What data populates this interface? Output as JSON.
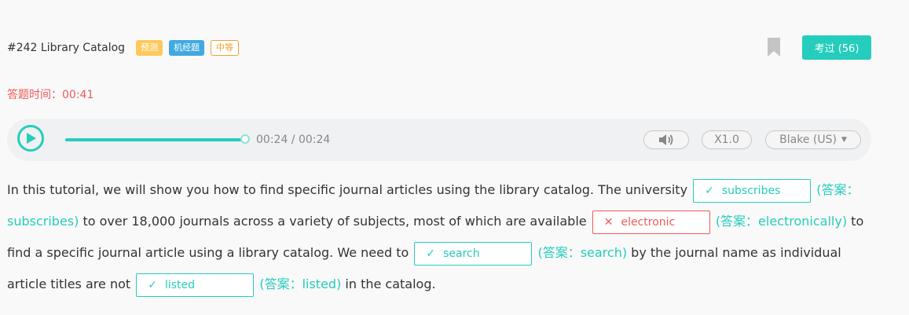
{
  "header": {
    "title": "#242 Library Catalog",
    "tags": [
      "预测",
      "机经题",
      "中等"
    ],
    "passed_label": "考过 (56)"
  },
  "timer": {
    "label": "答题时间：",
    "value": "00:41"
  },
  "player": {
    "time": "00:24 / 00:24",
    "progress": 1.0,
    "speed": "X1.0",
    "voice": "Blake (US)"
  },
  "passage": {
    "p1": "In this tutorial, we will show you how to find specific journal articles using the library catalog. The university",
    "b1": "subscribes",
    "a1": "(答案：subscribes)",
    "p2": " to over 18,000 journals across a variety of subjects, most of which are available",
    "b2": "electronic",
    "a2": "(答案：electronically)",
    "p3": " to find a specific journal article using a library catalog. We need to",
    "b3": "search",
    "a3": "(答案：search)",
    "p4": " by the journal name as individual article titles are not",
    "b4": "listed",
    "a4": "(答案：listed)",
    "p5": " in the catalog."
  },
  "marks": {
    "correct": "✓",
    "wrong": "✕"
  },
  "colors": {
    "accent": "#25cdbc",
    "error": "#ee5a5a",
    "tag_predict": "#fdc95c",
    "tag_jijing": "#41a9e0",
    "tag_medium": "#f0a030"
  }
}
